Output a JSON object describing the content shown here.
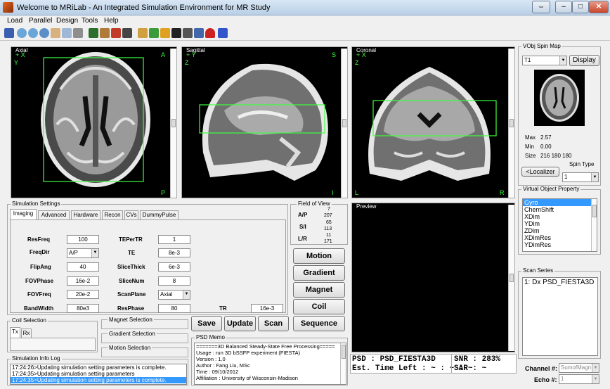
{
  "window": {
    "title": "Welcome to MRiLab - An Integrated Simulation Environment for MR Study",
    "btn_restore": "⇔",
    "btn_minimize": "–",
    "btn_maximize": "□",
    "btn_close": "✕"
  },
  "menu": {
    "items": [
      "Load",
      "Parallel",
      "Design",
      "Tools",
      "Help"
    ]
  },
  "toolbar": {
    "icons": [
      "save-icon",
      "zoom-in-icon",
      "zoom-out-icon",
      "rotate-icon",
      "pan-icon",
      "data-cursor-icon",
      "print-icon",
      "edit-icon",
      "ruler-icon",
      "signal-icon",
      "tools-icon",
      "coil-icon",
      "grid-icon",
      "rf-pulse-icon",
      "image-icon",
      "plot-icon",
      "graph-icon",
      "magnet-icon",
      "run-icon"
    ]
  },
  "views": {
    "axial": {
      "label": "Axial",
      "tl1": "+ X",
      "tl2": "Y",
      "tr": "A",
      "br": "P"
    },
    "sagittal": {
      "label": "Sagittal",
      "tl1": "+ Y",
      "tl2": "Z",
      "tr": "S",
      "br": "I"
    },
    "coronal": {
      "label": "Coronal",
      "tl1": "+ X",
      "tl2": "Z",
      "bl": "L",
      "br": "R"
    }
  },
  "spin_map": {
    "title": "VObj Spin Map",
    "select_value": "T1",
    "display_label": "Display",
    "max_label": "Max",
    "max_value": "2.57",
    "min_label": "Min",
    "min_value": "0.00",
    "size_label": "Size",
    "size_value": "216  180  180",
    "localizer_label": "<Localizer",
    "spin_type_label": "Spin Type",
    "spin_type_value": "1"
  },
  "sim_settings": {
    "title": "Simulation Settings",
    "tabs": [
      "Imaging",
      "Advanced",
      "Hardware",
      "Recon",
      "CVs",
      "DummyPulse"
    ],
    "left": [
      {
        "label": "ResFreq",
        "value": "100"
      },
      {
        "label": "FreqDir",
        "value": "A/P"
      },
      {
        "label": "FlipAng",
        "value": "40"
      },
      {
        "label": "FOVPhase",
        "value": "16e-2"
      },
      {
        "label": "FOVFreq",
        "value": "20e-2"
      },
      {
        "label": "BandWidth",
        "value": "80e3"
      }
    ],
    "right": [
      {
        "label": "TEPerTR",
        "value": "1"
      },
      {
        "label": "TE",
        "value": "8e-3"
      },
      {
        "label": "SliceThick",
        "value": "6e-3"
      },
      {
        "label": "SliceNum",
        "value": "8"
      },
      {
        "label": "ScanPlane",
        "value": "Axial"
      },
      {
        "label": "ResPhase",
        "value": "80"
      }
    ],
    "tr_label": "TR",
    "tr_value": "16e-3"
  },
  "fov": {
    "title": "Field of View",
    "ap_label": "A/P",
    "ap_values": [
      "7",
      "207"
    ],
    "si_label": "S/I",
    "si_values": [
      "65",
      "113"
    ],
    "lr_label": "L/R",
    "lr_values": [
      "11",
      "171"
    ]
  },
  "side_buttons": [
    "Motion",
    "Gradient",
    "Magnet",
    "Coil",
    "Sequence"
  ],
  "action_buttons": {
    "save": "Save",
    "update": "Update",
    "scan": "Scan"
  },
  "coil_selection": {
    "title": "Coil Selection",
    "tabs": [
      "Tx",
      "Rx"
    ]
  },
  "selections": {
    "magnet": "Magnet Selection",
    "gradient": "Gradient Selection",
    "motion": "Motion Selection"
  },
  "preview": {
    "title": "Preview",
    "psd_line": "PSD : PSD_FIESTA3D",
    "time_line": "Est. Time Left : ~ : ~ : ~",
    "snr_line": "SNR : 283%",
    "sar_line": "SAR : ~"
  },
  "psd_memo": {
    "title": "PSD Memo",
    "lines": [
      "=======3D Balanced Steady-State Free Processing=====",
      "Usage : run 3D bSSFP experiment (FIESTA)",
      "Version : 1.0",
      "Author : Fang Liu, MSc",
      "Time : 09/10/2012",
      "Affiliation : University of Wisconsin-Madison"
    ]
  },
  "info_log": {
    "title": "Simulation Info Log",
    "lines": [
      "17:24:26>Updating simulation setting parameters is complete.",
      "17:24:35>Updating simulation setting parameters",
      "17:24:35>Updating simulation setting parameters is complete."
    ]
  },
  "vobj_property": {
    "title": "Virtual Object Property",
    "items": [
      "Gyro",
      "ChemShift",
      "XDim",
      "YDim",
      "ZDim",
      "XDimRes",
      "YDimRes"
    ]
  },
  "scan_series": {
    "title": "Scan Series",
    "item": "1:   Dx PSD_FIESTA3D"
  },
  "channel": {
    "label": "Channel #:",
    "value": "SumofMagn"
  },
  "echo": {
    "label": "Echo #:",
    "value": "1"
  },
  "colors": {
    "overlay_green": "#3dff3d",
    "select_blue": "#3399ff"
  }
}
